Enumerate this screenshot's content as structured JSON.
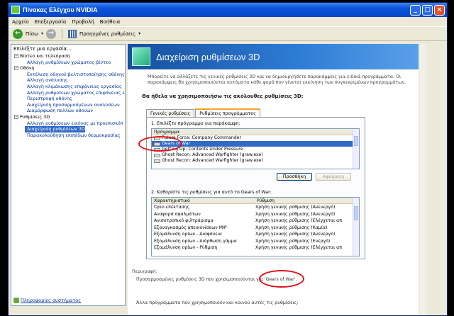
{
  "window": {
    "title": "Πίνακας Ελέγχου NVIDIA"
  },
  "menu": [
    "Αρχείο",
    "Επεξεργασία",
    "Προβολή",
    "Βοήθεια"
  ],
  "toolbar": {
    "back": "Πίσω",
    "advanced": "Προηγμένες ρυθμίσεις"
  },
  "sidebar": {
    "header": "Επιλέξτε μια εργασία...",
    "tree": [
      {
        "type": "cat",
        "label": "Βίντεο και τηλεόραση"
      },
      {
        "type": "item",
        "label": "Αλλαγή ρυθμίσεων χρώματος βίντεο"
      },
      {
        "type": "cat",
        "label": "Οθόνη"
      },
      {
        "type": "item",
        "label": "Εκτέλεση οδηγού βελτιστοποίησης οθόνης"
      },
      {
        "type": "item",
        "label": "Αλλαγή ανάλυσης"
      },
      {
        "type": "item",
        "label": "Αλλαγή κλιμάκωσης επιφάνειας εργασίας"
      },
      {
        "type": "item",
        "label": "Αλλαγή ρυθμίσεων χρώματος επιφάνειας ε"
      },
      {
        "type": "item",
        "label": "Περιστροφή οθόνης"
      },
      {
        "type": "item",
        "label": "Διαχείριση προσαρμοσμένων αναλύσεων"
      },
      {
        "type": "item",
        "label": "Διαμόρφωση πολλών οθονών"
      },
      {
        "type": "cat",
        "label": "Ρυθμίσεις 3D"
      },
      {
        "type": "item",
        "label": "Αλλαγή ρυθμίσεων εικόνας με προεπισκόπ"
      },
      {
        "type": "sel",
        "label": "Διαχείριση ρυθμίσεων 3D"
      },
      {
        "type": "item",
        "label": "Παρακολούθηση επιπέδων θερμοκρασίας"
      }
    ],
    "help_link": "Πληροφορίες συστήματος"
  },
  "banner": {
    "title": "Διαχείριση ρυθμίσεων 3D"
  },
  "intro": [
    "Μπορείτε να αλλάξετε τις γενικές ρυθμίσεις 3D και να δημιουργήσετε παρακάμψεις για ειδικά προγράμματα. Οι",
    "παρακάμψεις θα χρησιμοποιούνται αυτόματα κάθε φορά που γίνεται εκκίνηση των συγκεκριμένων προγραμμάτων."
  ],
  "question": "Θα ήθελα να χρησιμοποιήσω τις ακόλουθες ρυθμίσεις 3D:",
  "tabs": [
    "Γενικές ρυθμίσεις",
    "Ρυθμίσεις προγράμματος"
  ],
  "step1": {
    "label": "1. Επιλέξτε πρόγραμμα για παράκαμψη:",
    "header": "Πρόγραμμα",
    "rows": [
      "Future Force: Company Commander",
      "Gears of War",
      "Getting Up: Contents Under Pressure",
      "Ghost Recon: Advanced Warfighter (graw.exe)",
      "Ghost Recon: Advanced Warfighter (graw.exe)"
    ],
    "selected": 1,
    "add": "Προσθήκη",
    "remove": "Αφαίρεση"
  },
  "step2": {
    "label": "2. Καθορίστε τις ρυθμίσεις για αυτό το Gears of War:",
    "headers": [
      "Χαρακτηριστικό",
      "Ρύθμιση"
    ],
    "rows": [
      [
        "Όριο επέκτασης",
        "Χρήση γενικής ρύθμισης (Ανενεργό)"
      ],
      [
        "Αναφορά σφαλμάτων",
        "Χρήση γενικής ρύθμισης (Ανενεργό)"
      ],
      [
        "Ανισοτροπικό φιλτράρισμα",
        "Χρήση γενικής ρύθμισης (Ελέγχεται απ"
      ],
      [
        "Εξαναγκασμός απεικονίσεων MIP",
        "Χρήση γενικής ρύθμισης (Καμία)"
      ],
      [
        "Εξομάλυνση ορίων - Διαφάνεια",
        "Χρήση γενικής ρύθμισης (Ανενεργό)"
      ],
      [
        "Εξομάλυνση ορίων - Διόρθωση γάμμα",
        "Χρήση γενικής ρύθμισης (Ενεργό)"
      ],
      [
        "Εξομάλυνση ορίων - Ρύθμιση",
        "Χρήση γενικής ρύθμισης (Ελέγχεται απ"
      ]
    ]
  },
  "description": {
    "label": "Περιγραφή:",
    "text": "Προσαρμοσμένες ρυθμίσεις 3D που χρησιμοποιούνται για 'Gears of War'.",
    "footer": "Άλλα προγράμματα που χρησιμοποιούν και κοινού αυτές τις ρυθμίσεις:"
  },
  "colors": {
    "accent": "#316ac5",
    "highlight_ring": "#e0121b",
    "banner": "#174f9e"
  }
}
